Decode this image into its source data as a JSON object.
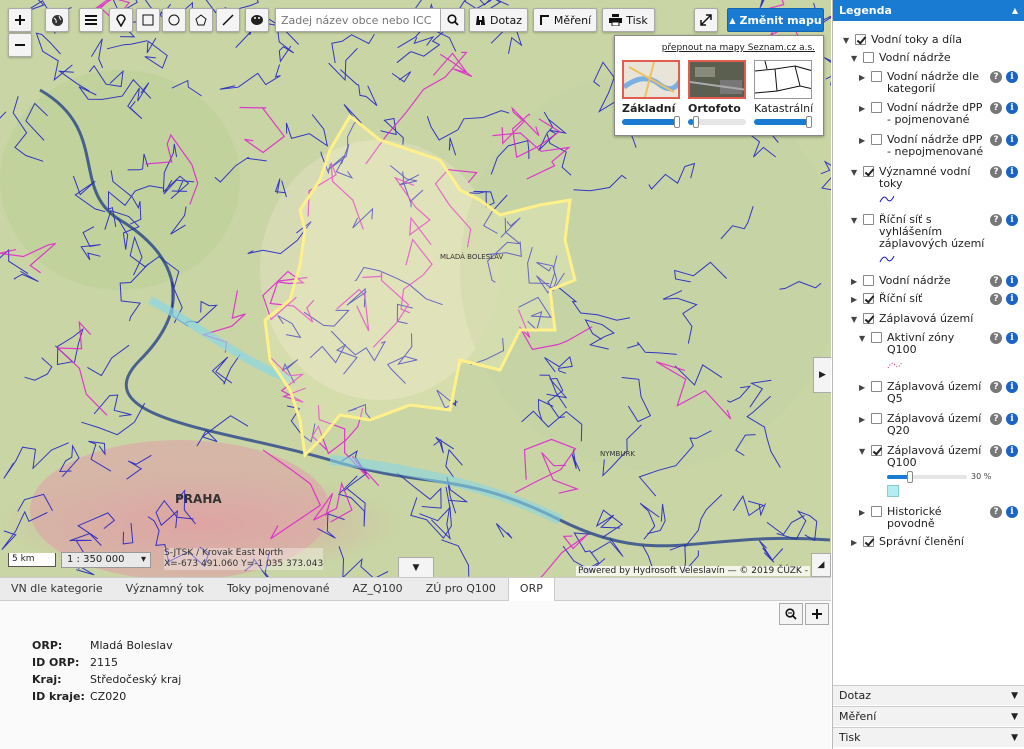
{
  "toolbar": {
    "search_placeholder": "Zadej název obce nebo ICC",
    "dotaz": "Dotaz",
    "mereni": "Měření",
    "tisk": "Tisk",
    "change_map": "Změnit mapu"
  },
  "basemaps": {
    "switch_link": "přepnout na mapy Seznam.cz a.s.",
    "items": [
      {
        "name": "Základní",
        "opacity": 0.95
      },
      {
        "name": "Ortofoto",
        "opacity": 0.05
      },
      {
        "name": "Katastrální",
        "opacity": 0.95
      }
    ]
  },
  "map": {
    "labels": [
      "PRAHA",
      "MLADÁ BOLESLAV",
      "NYMBURK"
    ],
    "scale_bar": "5 km",
    "scale_value": "1 : 350 000",
    "coords_line1": "S-JTSK / Krovak East North",
    "coords_line2": "X=-673 491.060 Y=-1 035 373.043",
    "attribution": "Powered by Hydrosoft Veleslavín — © 2019 ČÚZK -"
  },
  "tabs": [
    "VN dle kategorie",
    "Významný tok",
    "Toky pojmenované",
    "AZ_Q100",
    "ZÚ pro Q100",
    "ORP"
  ],
  "active_tab": "ORP",
  "info": {
    "rows": [
      {
        "key": "ORP",
        "value": "Mladá Boleslav"
      },
      {
        "key": "ID ORP",
        "value": "2115"
      },
      {
        "key": "Kraj",
        "value": "Středočeský kraj"
      },
      {
        "key": "ID kraje",
        "value": "CZ020"
      }
    ]
  },
  "legend": {
    "title": "Legenda",
    "items": [
      {
        "label": "Vodní toky a díla",
        "checked": true
      },
      {
        "label": "Vodní nádrže",
        "checked": false
      },
      {
        "label": "Vodní nádrže dle kategorií",
        "checked": false
      },
      {
        "label": "Vodní nádrže dPP - pojmenované",
        "checked": false
      },
      {
        "label": "Vodní nádrže dPP - nepojmenované",
        "checked": false
      },
      {
        "label": "Významné vodní toky",
        "checked": true
      },
      {
        "label": "Říční síť s vyhlášením záplavových území",
        "checked": false
      },
      {
        "label": "Vodní nádrže",
        "checked": false
      },
      {
        "label": "Říční síť",
        "checked": true
      },
      {
        "label": "Záplavová území",
        "checked": true
      },
      {
        "label": "Aktivní zóny Q100",
        "checked": false
      },
      {
        "label": "Záplavová území Q5",
        "checked": false
      },
      {
        "label": "Záplavová území Q20",
        "checked": false
      },
      {
        "label": "Záplavová území Q100",
        "checked": true
      },
      {
        "label": "Historické povodně",
        "checked": false
      },
      {
        "label": "Správní členění",
        "checked": true
      }
    ],
    "q100_opacity": "30 %",
    "accordion": [
      "Dotaz",
      "Měření",
      "Tisk"
    ]
  }
}
